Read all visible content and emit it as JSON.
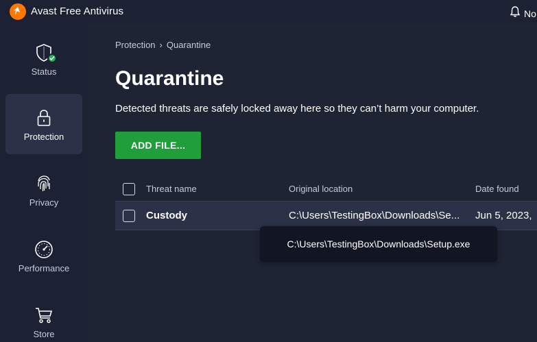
{
  "app": {
    "title": "Avast Free Antivirus",
    "notifications_label": "No"
  },
  "sidebar": {
    "items": [
      {
        "label": "Status",
        "icon": "shield-check-icon",
        "active": false
      },
      {
        "label": "Protection",
        "icon": "lock-icon",
        "active": true
      },
      {
        "label": "Privacy",
        "icon": "fingerprint-icon",
        "active": false
      },
      {
        "label": "Performance",
        "icon": "gauge-icon",
        "active": false
      },
      {
        "label": "Store",
        "icon": "cart-icon",
        "active": false
      }
    ]
  },
  "breadcrumb": {
    "parent": "Protection",
    "separator": "›",
    "current": "Quarantine"
  },
  "page": {
    "title": "Quarantine",
    "subtitle": "Detected threats are safely locked away here so they can’t harm your computer.",
    "add_button": "ADD FILE..."
  },
  "table": {
    "headers": {
      "name": "Threat name",
      "location": "Original location",
      "date": "Date found"
    },
    "rows": [
      {
        "name": "Custody",
        "location": "C:\\Users\\TestingBox\\Downloads\\Se...",
        "date": "Jun 5, 2023,"
      }
    ]
  },
  "tooltip": {
    "text": "C:\\Users\\TestingBox\\Downloads\\Setup.exe"
  },
  "colors": {
    "background": "#1f2435",
    "sidebar": "#1c2133",
    "active_item": "#2b3147",
    "accent_green": "#1f9e3a",
    "logo_orange": "#ff7800"
  }
}
